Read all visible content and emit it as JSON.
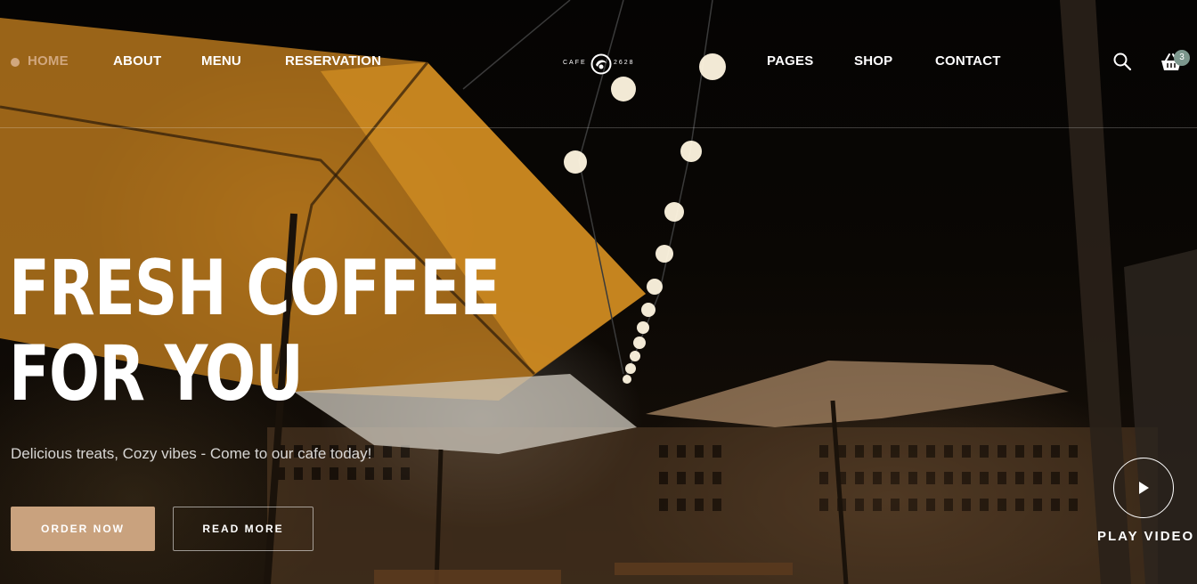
{
  "nav": {
    "left_items": [
      {
        "label": "HOME",
        "active": true
      },
      {
        "label": "ABOUT"
      },
      {
        "label": "MENU"
      },
      {
        "label": "RESERVATION"
      }
    ],
    "right_items": [
      {
        "label": "PAGES"
      },
      {
        "label": "SHOP"
      },
      {
        "label": "CONTACT"
      }
    ],
    "logo": {
      "text_left": "CAFE",
      "text_right": "2628"
    },
    "cart_count": "3",
    "icons": {
      "search": "search-icon",
      "cart": "basket-icon"
    }
  },
  "hero": {
    "title_line1": "FRESH COFFEE",
    "title_line2": "FOR YOU",
    "subtitle": "Delicious treats, Cozy vibes - Come to our cafe today!",
    "primary_button": "ORDER NOW",
    "secondary_button": "READ MORE",
    "video_label": "PLAY VIDEO",
    "icons": {
      "play": "play-icon"
    }
  },
  "colors": {
    "accent": "#d1a77e",
    "button": "#c9a27e",
    "badge": "#7c978d",
    "text": "#ffffff"
  }
}
